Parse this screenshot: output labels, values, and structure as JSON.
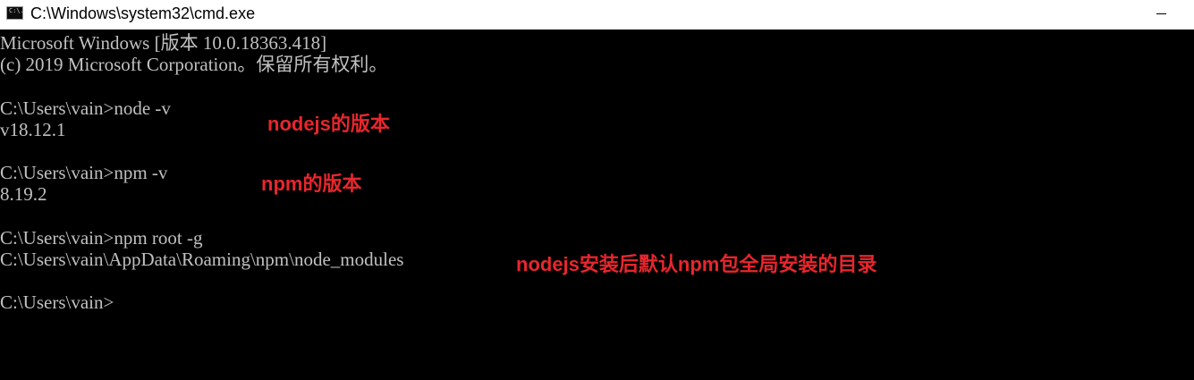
{
  "window": {
    "title": "C:\\Windows\\system32\\cmd.exe",
    "icon_text": "C:\\."
  },
  "console": {
    "lines": [
      "Microsoft Windows [版本 10.0.18363.418]",
      "(c) 2019 Microsoft Corporation。保留所有权利。",
      "",
      "C:\\Users\\vain>node -v",
      "v18.12.1",
      "",
      "C:\\Users\\vain>npm -v",
      "8.19.2",
      "",
      "C:\\Users\\vain>npm root -g",
      "C:\\Users\\vain\\AppData\\Roaming\\npm\\node_modules",
      "",
      "C:\\Users\\vain>"
    ]
  },
  "annotations": {
    "node_version": "nodejs的版本",
    "npm_version": "npm的版本",
    "global_dir": "nodejs安装后默认npm包全局安装的目录"
  },
  "colors": {
    "terminal_bg": "#000000",
    "terminal_text": "#c0c0c0",
    "annotation": "#e8262d",
    "titlebar_bg": "#ffffff"
  }
}
